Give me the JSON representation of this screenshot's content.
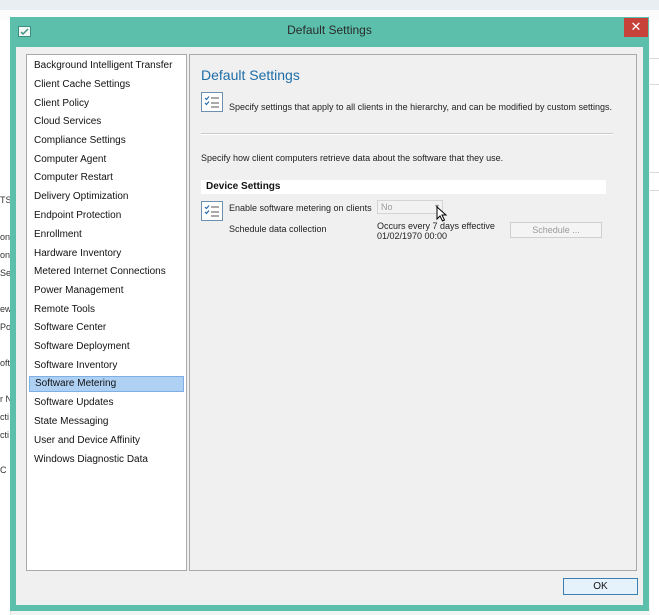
{
  "window": {
    "title": "Default Settings",
    "close_glyph": "✕",
    "accent_color": "#5bbfab"
  },
  "sidebar": {
    "items": [
      {
        "label": "Background Intelligent Transfer",
        "selected": false
      },
      {
        "label": "Client Cache Settings",
        "selected": false
      },
      {
        "label": "Client Policy",
        "selected": false
      },
      {
        "label": "Cloud Services",
        "selected": false
      },
      {
        "label": "Compliance Settings",
        "selected": false
      },
      {
        "label": "Computer Agent",
        "selected": false
      },
      {
        "label": "Computer Restart",
        "selected": false
      },
      {
        "label": "Delivery Optimization",
        "selected": false
      },
      {
        "label": "Endpoint Protection",
        "selected": false
      },
      {
        "label": "Enrollment",
        "selected": false
      },
      {
        "label": "Hardware Inventory",
        "selected": false
      },
      {
        "label": "Metered Internet Connections",
        "selected": false
      },
      {
        "label": "Power Management",
        "selected": false
      },
      {
        "label": "Remote Tools",
        "selected": false
      },
      {
        "label": "Software Center",
        "selected": false
      },
      {
        "label": "Software Deployment",
        "selected": false
      },
      {
        "label": "Software Inventory",
        "selected": false
      },
      {
        "label": "Software Metering",
        "selected": true
      },
      {
        "label": "Software Updates",
        "selected": false
      },
      {
        "label": "State Messaging",
        "selected": false
      },
      {
        "label": "User and Device Affinity",
        "selected": false
      },
      {
        "label": "Windows Diagnostic Data",
        "selected": false
      }
    ]
  },
  "main": {
    "heading": "Default Settings",
    "description": "Specify settings that apply to all clients in the hierarchy, and can be modified by custom settings.",
    "specify_text": "Specify how client computers retrieve data about the software that they use.",
    "group_title": "Device Settings",
    "enable_label": "Enable software metering on clients",
    "enable_value": "No",
    "schedule_label": "Schedule data collection",
    "occurs_line1": "Occurs every 7 days effective",
    "occurs_line2": "01/02/1970 00:00",
    "schedule_button": "Schedule ..."
  },
  "footer": {
    "ok_label": "OK"
  },
  "background": {
    "fragments": [
      "TS",
      "on",
      "on",
      "Se",
      "ew",
      "Po",
      "oft",
      "r N",
      "cti",
      "cti",
      "C"
    ]
  }
}
